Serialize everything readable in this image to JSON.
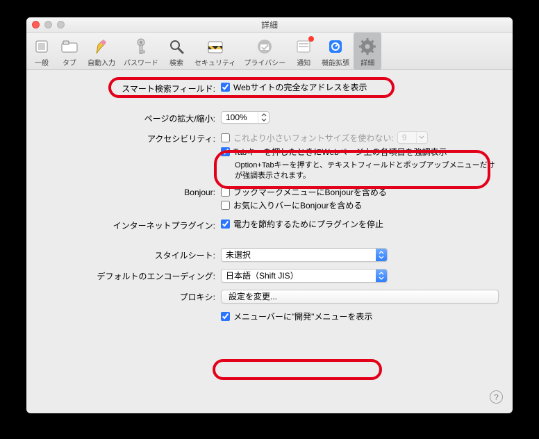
{
  "window": {
    "title": "詳細"
  },
  "toolbar": {
    "items": [
      {
        "label": "一般"
      },
      {
        "label": "タブ"
      },
      {
        "label": "自動入力"
      },
      {
        "label": "パスワード"
      },
      {
        "label": "検索"
      },
      {
        "label": "セキュリティ"
      },
      {
        "label": "プライバシー"
      },
      {
        "label": "通知"
      },
      {
        "label": "機能拡張"
      },
      {
        "label": "詳細"
      }
    ]
  },
  "labels": {
    "smart_search": "スマート検索フィールド:",
    "zoom": "ページの拡大/縮小:",
    "accessibility": "アクセシビリティ:",
    "bonjour": "Bonjour:",
    "plugins": "インターネットプラグイン:",
    "stylesheet": "スタイルシート:",
    "encoding": "デフォルトのエンコーディング:",
    "proxy": "プロキシ:"
  },
  "fields": {
    "show_full_address": "Webサイトの完全なアドレスを表示",
    "zoom_value": "100%",
    "font_min_check": "これより小さいフォントサイズを使わない:",
    "font_min_value": "9",
    "tab_highlight": "Tabキーを押したときにWebページ上の各項目を強調表示",
    "tab_hint": "Option+Tabキーを押すと、テキストフィールドとポップアップメニューだけが強調表示されます。",
    "bonjour_bookmarks": "ブックマークメニューにBonjourを含める",
    "bonjour_favorites": "お気に入りバーにBonjourを含める",
    "plugins_stop": "電力を節約するためにプラグインを停止",
    "stylesheet_value": "未選択",
    "encoding_value": "日本語（Shift JIS）",
    "proxy_button": "設定を変更...",
    "develop_menu": "メニューバーに\"開発\"メニューを表示"
  },
  "help": "?"
}
